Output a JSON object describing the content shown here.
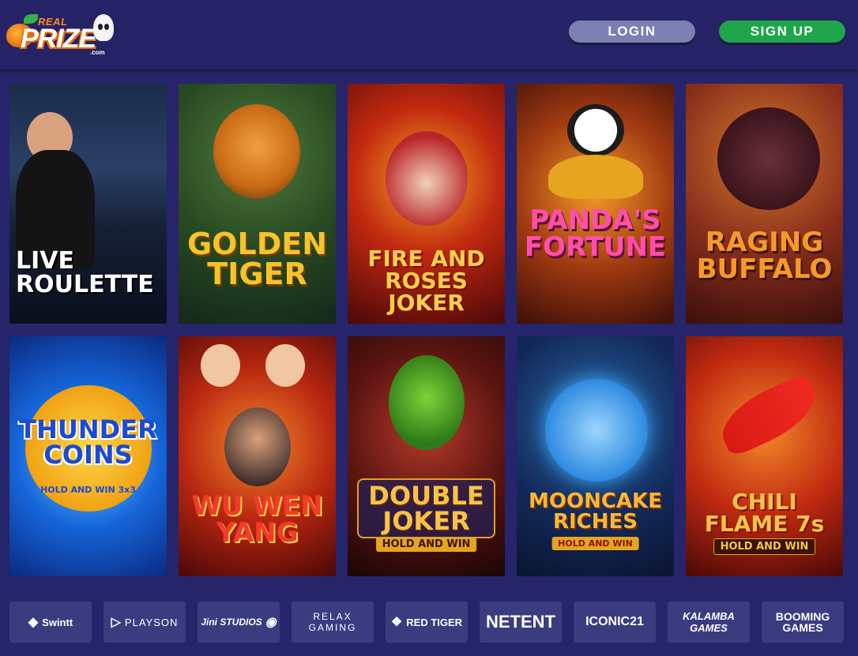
{
  "header": {
    "logo": {
      "top": "REAL",
      "main": "PRIZE",
      "suffix": ".com"
    },
    "login_label": "LOGIN",
    "signup_label": "SIGN UP"
  },
  "games": [
    {
      "name": "live-roulette",
      "title": "LIVE\nROULETTE",
      "sub": ""
    },
    {
      "name": "golden-tiger",
      "title": "GOLDEN\nTIGER",
      "sub": ""
    },
    {
      "name": "fire-and-roses-joker",
      "title": "FIRE AND ROSES\nJOKER",
      "sub": ""
    },
    {
      "name": "pandas-fortune",
      "title": "PANDA'S\nFORTUNE",
      "sub": ""
    },
    {
      "name": "raging-buffalo",
      "title": "RAGING\nBUFFALO",
      "sub": ""
    },
    {
      "name": "thunder-coins",
      "title": "THUNDER\nCOINS",
      "sub": "HOLD AND WIN 3x3"
    },
    {
      "name": "wu-wen-yang",
      "title": "WU WEN\nYANG",
      "sub": ""
    },
    {
      "name": "double-joker",
      "title": "DOUBLE\nJOKER",
      "sub": "HOLD AND WIN"
    },
    {
      "name": "mooncake-riches",
      "title": "MOONCAKE\nRICHES",
      "sub": "HOLD AND WIN"
    },
    {
      "name": "chili-flame-7s",
      "title": "CHILI\nFLAME 7s",
      "sub": "HOLD AND WIN"
    }
  ],
  "providers": [
    {
      "name": "swintt",
      "label": "Swintt",
      "icon": "swintt-icon"
    },
    {
      "name": "playson",
      "label": "PLAYSON",
      "icon": "playson-icon"
    },
    {
      "name": "jini-studios",
      "label": "Jini STUDIOS",
      "icon": "jini-icon"
    },
    {
      "name": "relax-gaming",
      "label": "RELAX GAMING",
      "icon": ""
    },
    {
      "name": "red-tiger",
      "label": "RED TIGER",
      "icon": "red-tiger-icon"
    },
    {
      "name": "netent",
      "label": "NETENT",
      "icon": ""
    },
    {
      "name": "iconic21",
      "label": "ICONIC21",
      "icon": ""
    },
    {
      "name": "kalamba",
      "label": "KALAMBA GAMES",
      "icon": ""
    },
    {
      "name": "booming-games",
      "label": "BOOMING GAMES",
      "icon": ""
    }
  ],
  "colors": {
    "background": "#26246a",
    "login": "#7c7fb2",
    "signup": "#1fa64b",
    "provider_tile": "#3b3c80"
  }
}
